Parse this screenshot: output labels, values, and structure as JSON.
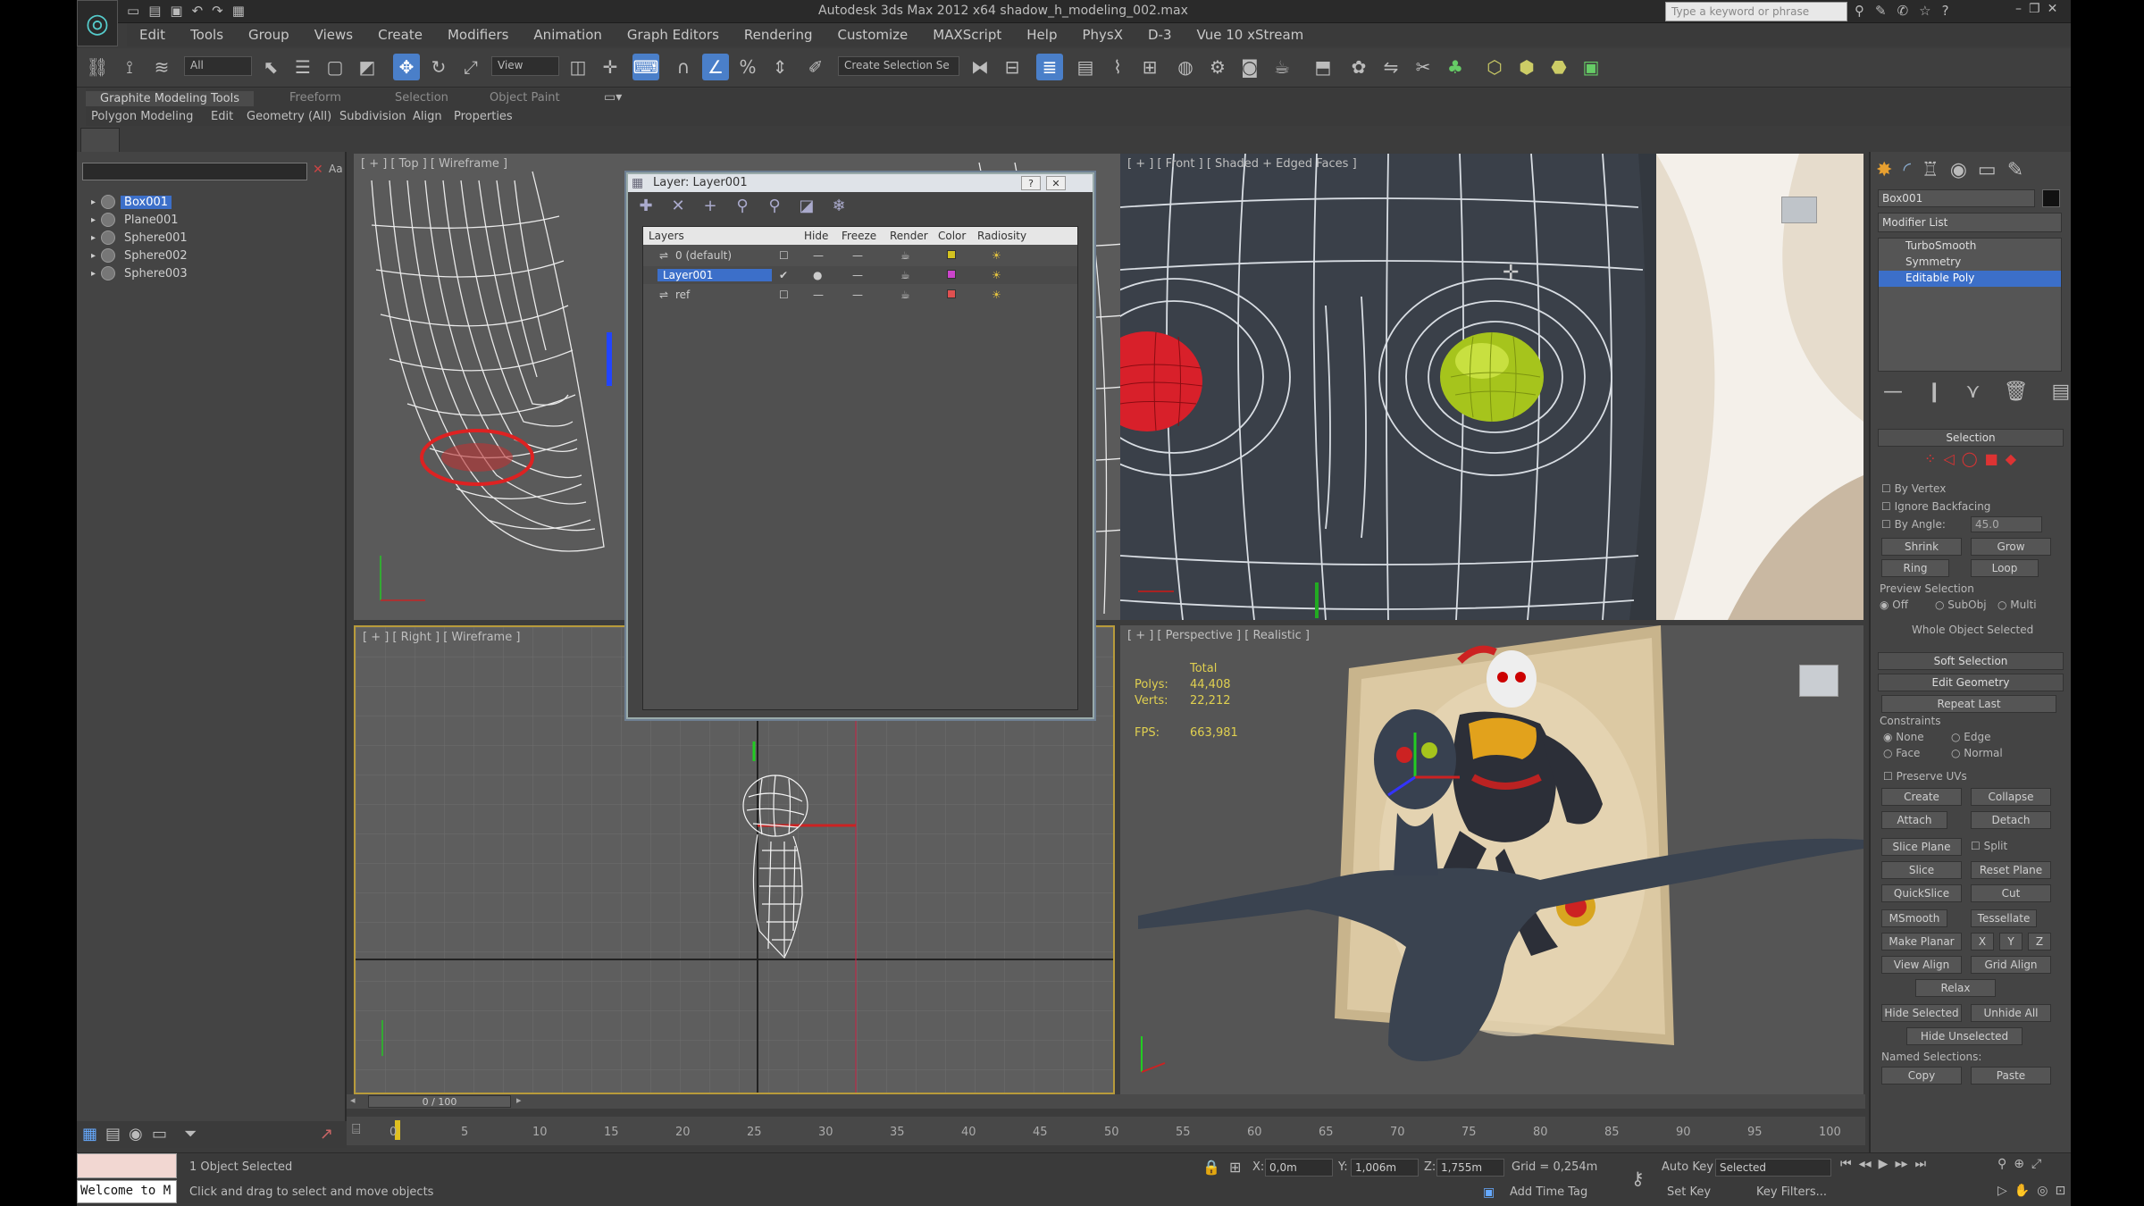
{
  "window": {
    "title": "Autodesk 3ds Max 2012 x64     shadow_h_modeling_002.max",
    "search_placeholder": "Type a keyword or phrase"
  },
  "menu": [
    "Edit",
    "Tools",
    "Group",
    "Views",
    "Create",
    "Modifiers",
    "Animation",
    "Graph Editors",
    "Rendering",
    "Customize",
    "MAXScript",
    "Help",
    "PhysX",
    "D-3",
    "Vue 10 xStream"
  ],
  "toolbar": {
    "filter": "All",
    "view": "View",
    "named_selection": "Create Selection Se"
  },
  "ribbon": {
    "tabs": [
      "Graphite Modeling Tools",
      "Freeform",
      "Selection",
      "Object Paint"
    ],
    "subtabs": [
      "Polygon Modeling",
      "Edit",
      "Geometry (All)",
      "Subdivision",
      "Align",
      "Properties"
    ]
  },
  "explorer": {
    "items": [
      "Box001",
      "Plane001",
      "Sphere001",
      "Sphere002",
      "Sphere003"
    ]
  },
  "viewports": {
    "top": "[ + ] [ Top ] [ Wireframe ]",
    "front": "[ + ] [ Front ] [ Shaded + Edged Faces ]",
    "right": "[ + ] [ Right ] [ Wireframe ]",
    "perspective": "[ + ] [ Perspective ] [ Realistic ]"
  },
  "stats": {
    "total": "Total",
    "polys_label": "Polys:",
    "polys": "44,408",
    "verts_label": "Verts:",
    "verts": "22,212",
    "fps_label": "FPS:",
    "fps": "663,981"
  },
  "layer_dialog": {
    "title": "Layer: Layer001",
    "columns": [
      "Layers",
      "Hide",
      "Freeze",
      "Render",
      "Color",
      "Radiosity"
    ],
    "rows": [
      {
        "name": "0 (default)",
        "color": "#d4c320"
      },
      {
        "name": "Layer001",
        "color": "#cc44cc"
      },
      {
        "name": "ref",
        "color": "#e05050"
      }
    ]
  },
  "command_panel": {
    "object_name": "Box001",
    "modifier_list": "Modifier List",
    "stack": [
      "TurboSmooth",
      "Symmetry",
      "Editable Poly"
    ],
    "selection_header": "Selection",
    "by_vertex": "By Vertex",
    "ignore_backfacing": "Ignore Backfacing",
    "by_angle": "By Angle:",
    "by_angle_value": "45.0",
    "shrink": "Shrink",
    "grow": "Grow",
    "ring": "Ring",
    "loop": "Loop",
    "preview_selection": "Preview Selection",
    "preview_options": [
      "Off",
      "SubObj",
      "Multi"
    ],
    "whole_object_selected": "Whole Object Selected",
    "soft_selection": "Soft Selection",
    "edit_geometry": "Edit Geometry",
    "repeat_last": "Repeat Last",
    "constraints": "Constraints",
    "constraint_options": [
      "None",
      "Edge",
      "Face",
      "Normal"
    ],
    "preserve_uvs": "Preserve UVs",
    "create": "Create",
    "collapse": "Collapse",
    "attach": "Attach",
    "detach": "Detach",
    "slice_plane": "Slice Plane",
    "split": "Split",
    "slice": "Slice",
    "reset_plane": "Reset Plane",
    "quickslice": "QuickSlice",
    "cut": "Cut",
    "msmooth": "MSmooth",
    "tessellate": "Tessellate",
    "make_planar": "Make Planar",
    "x": "X",
    "y": "Y",
    "z": "Z",
    "view_align": "View Align",
    "grid_align": "Grid Align",
    "relax": "Relax",
    "hide_selected": "Hide Selected",
    "unhide_all": "Unhide All",
    "hide_unselected": "Hide Unselected",
    "named_selections": "Named Selections:",
    "copy": "Copy",
    "paste": "Paste"
  },
  "timeline": {
    "frame": "0 / 100",
    "ticks": [
      "0",
      "5",
      "10",
      "15",
      "20",
      "25",
      "30",
      "35",
      "40",
      "45",
      "50",
      "55",
      "60",
      "65",
      "70",
      "75",
      "80",
      "85",
      "90",
      "95",
      "100"
    ]
  },
  "status": {
    "welcome": "Welcome to M",
    "objects": "1 Object Selected",
    "prompt": "Click and drag to select and move objects",
    "x": "0,0m",
    "y": "1,006m",
    "z": "1,755m",
    "grid": "Grid = 0,254m",
    "auto_key": "Auto Key",
    "selected": "Selected",
    "set_key": "Set Key",
    "key_filters": "Key Filters...",
    "add_time_tag": "Add Time Tag"
  }
}
